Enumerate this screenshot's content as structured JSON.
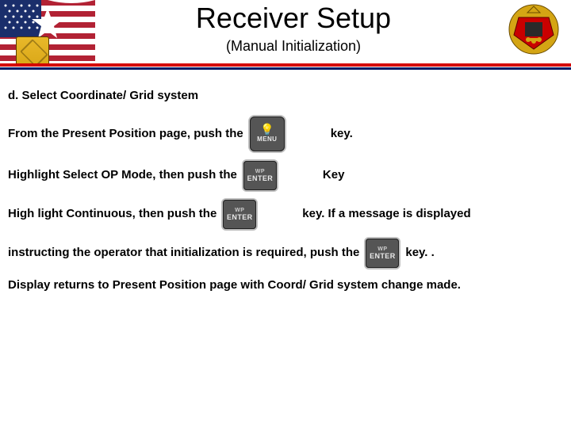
{
  "header": {
    "title": "Receiver Setup",
    "subtitle": "(Manual Initialization)"
  },
  "section": {
    "heading": "d. Select Coordinate/ Grid system",
    "line1_a": "From the Present Position page, push the",
    "line1_b": "key.",
    "line2_a": "Highlight Select OP Mode, then push the",
    "line2_b": "Key",
    "line3_a": "High light Continuous, then push the",
    "line3_b": "key. If a message is displayed",
    "line4_a": "instructing the operator that initialization is required, push the",
    "line4_b": "key. .",
    "line5": "Display returns to Present Position page with Coord/ Grid system change made."
  },
  "keys": {
    "menu_top": "MENU",
    "enter_top": "WP",
    "enter_bottom": "ENTER"
  }
}
